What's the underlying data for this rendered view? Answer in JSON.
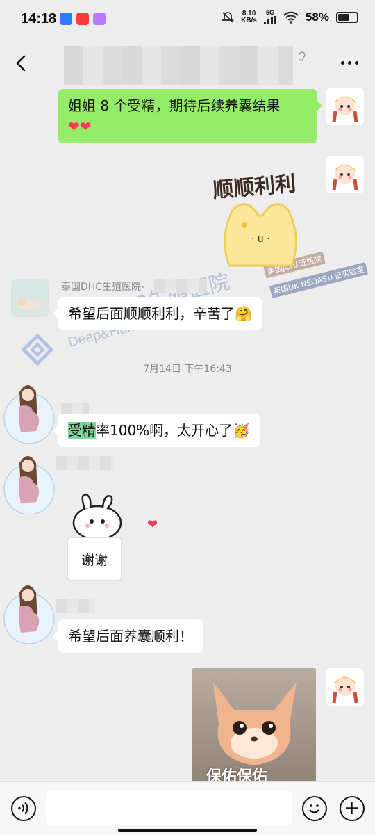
{
  "status_bar": {
    "time": "14:18",
    "net_speed_value": "8.10",
    "net_speed_unit": "KB/s",
    "network": "5G",
    "battery": "58%"
  },
  "header": {
    "title": "",
    "back_icon": "chevron-left-icon",
    "more_icon": "more-dots-icon"
  },
  "messages": {
    "m1": {
      "text": "姐姐 8 个受精，期待后续养囊结果",
      "hearts": "❤❤"
    },
    "m2": {
      "sticker_text": "顺顺利利"
    },
    "m3": {
      "sender": "泰国DHC生殖医院-",
      "text": "希望后面顺顺利利，辛苦了",
      "emoji": "🤗"
    },
    "timestamp": "7月14日 下午16:43",
    "m4": {
      "highlight": "受精",
      "text": "率100%啊，太开心了",
      "emoji": "🥳"
    },
    "m5": {
      "sticker_text": "谢谢",
      "heart": "❤"
    },
    "m6": {
      "text": "希望后面养囊顺利！"
    },
    "m7": {
      "sticker_text": "保佑保佑"
    }
  },
  "watermark": {
    "cn": "泰国DHC生殖医院",
    "en": "Deep&Harmonicare",
    "badge1": "美国JCI认证医院",
    "badge2": "英国UK NEQAS认证实验室"
  },
  "colors": {
    "my_bubble": "#95ec69",
    "other_bubble": "#ffffff",
    "background": "#ededed",
    "highlight": "#7ed89b"
  }
}
